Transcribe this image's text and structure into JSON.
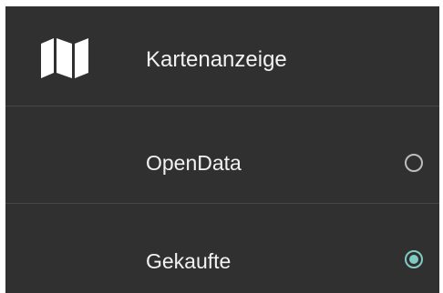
{
  "header": {
    "icon": "map-icon",
    "title": "Kartenanzeige"
  },
  "options": [
    {
      "label": "OpenData",
      "selected": false
    },
    {
      "label": "Gekaufte",
      "selected": true
    }
  ],
  "colors": {
    "background": "#303030",
    "text": "#f2f2f2",
    "divider": "#474747",
    "radio_unselected": "#bdbdbd",
    "radio_selected": "#80cbc4"
  }
}
